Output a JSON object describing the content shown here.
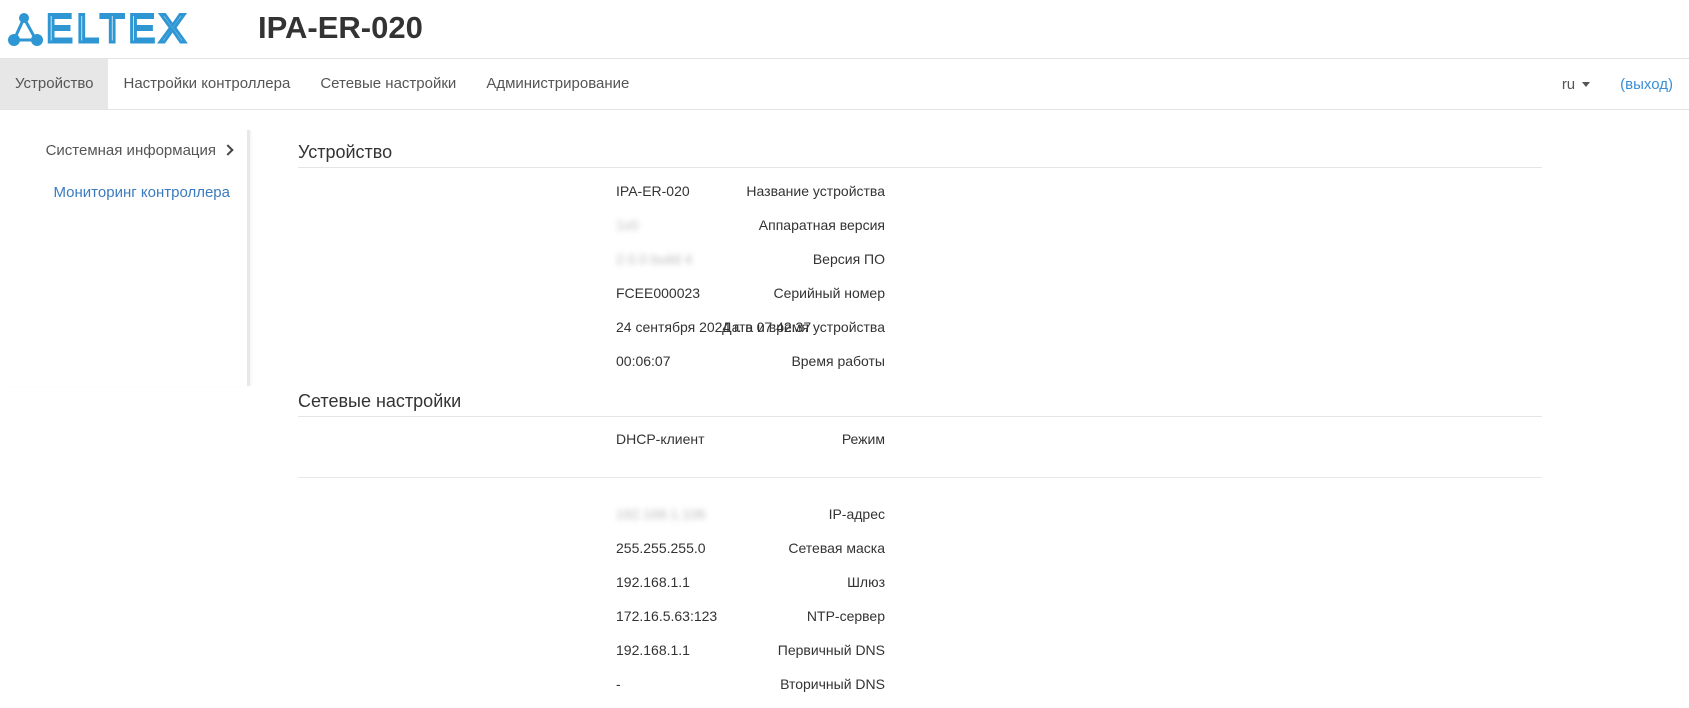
{
  "header": {
    "logo_text": "ELTEX",
    "device_title": "IPA-ER-020",
    "brand_color": "#2e96d3"
  },
  "nav": {
    "tabs": [
      {
        "label": "Устройство",
        "active": true
      },
      {
        "label": "Настройки контроллера",
        "active": false
      },
      {
        "label": "Сетевые настройки",
        "active": false
      },
      {
        "label": "Администрирование",
        "active": false
      }
    ],
    "lang": "ru",
    "logout": "(выход)"
  },
  "sidebar": {
    "items": [
      {
        "label": "Системная информация",
        "icon": "chevron-right-icon"
      },
      {
        "label": "Мониторинг контроллера"
      }
    ]
  },
  "device_section": {
    "title": "Устройство",
    "rows": [
      {
        "label": "Название устройства",
        "value": "IPA-ER-020"
      },
      {
        "label": "Аппаратная версия",
        "value": "1v0"
      },
      {
        "label": "Версия ПО",
        "value": "2.0.0 build 4"
      },
      {
        "label": "Серийный номер",
        "value": "FCEE000023"
      },
      {
        "label": "Дата и время устройства",
        "value": "24 сентября 2024 г. в 07:42:37"
      },
      {
        "label": "Время работы",
        "value": "00:06:07"
      }
    ]
  },
  "network_section": {
    "title": "Сетевые настройки",
    "mode": {
      "label": "Режим",
      "value": "DHCP-клиент"
    },
    "rows": [
      {
        "label": "IP-адрес",
        "value": "192.168.1.106"
      },
      {
        "label": "Сетевая маска",
        "value": "255.255.255.0"
      },
      {
        "label": "Шлюз",
        "value": "192.168.1.1"
      },
      {
        "label": "NTP-сервер",
        "value": "172.16.5.63:123"
      },
      {
        "label": "Первичный DNS",
        "value": "192.168.1.1"
      },
      {
        "label": "Вторичный DNS",
        "value": "-"
      }
    ]
  }
}
